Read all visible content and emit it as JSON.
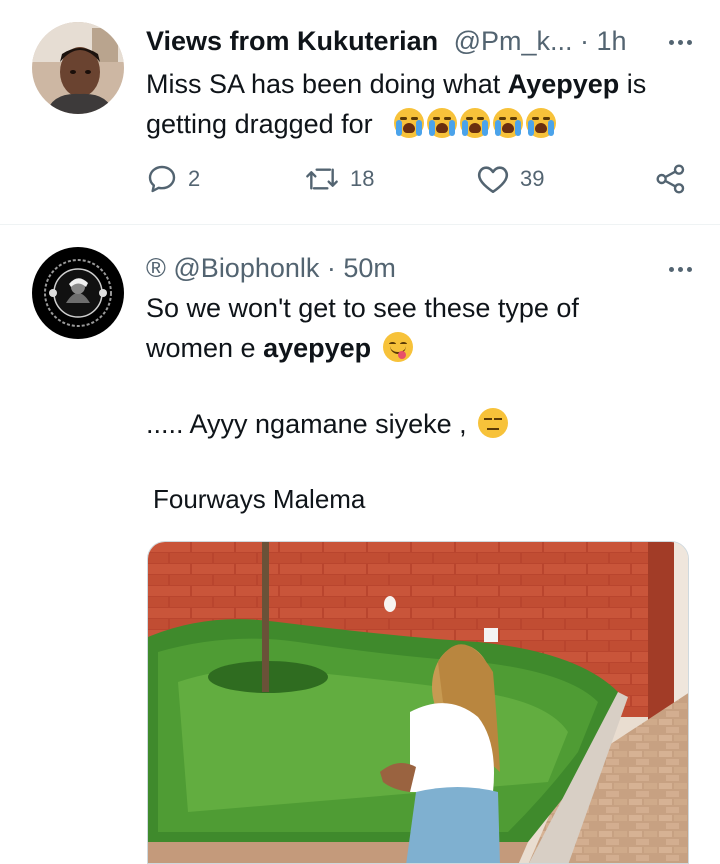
{
  "tweets": [
    {
      "display_name": "Views from Kukuterian",
      "handle_time": "@Pm_k... · 1h",
      "text_line1_pre": "Miss SA has been doing what ",
      "text_line1_bold": "Ayepyep",
      "text_line1_post": " is",
      "text_line2": "getting dragged for",
      "reply_count": "2",
      "retweet_count": "18",
      "like_count": "39"
    },
    {
      "handle_time": "® @Biophonlk · 50m",
      "line1": "So we won't get to see these type of",
      "line2_pre": "women e ",
      "line2_bold": "ayepyep",
      "line3": "..... Ayyy ngamane siyeke ,",
      "line4": "Fourways Malema"
    }
  ],
  "icons": {
    "reply": "reply-icon",
    "retweet": "retweet-icon",
    "like": "heart-icon",
    "share": "share-icon",
    "more": "more-options-icon"
  },
  "colors": {
    "text": "#0f1419",
    "secondary": "#536471",
    "divider": "#eff3f4"
  }
}
